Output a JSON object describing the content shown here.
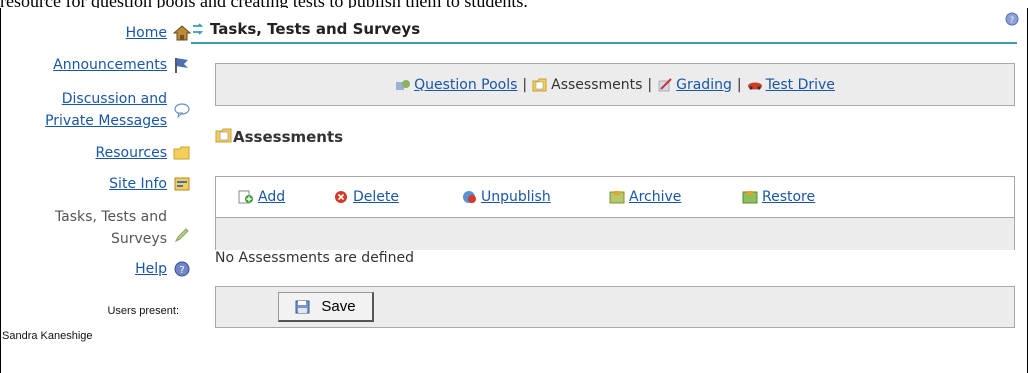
{
  "top_fragment": "resource for question pools and creating tests to publish them to students.",
  "sidebar": {
    "items": [
      {
        "label": "Home",
        "icon": "home-icon",
        "link": true
      },
      {
        "label": "Announcements",
        "icon": "flag-icon",
        "link": true
      },
      {
        "label": "Discussion and Private Messages",
        "line1": "Discussion and",
        "line2": "Private Messages",
        "icon": "chat-bubble-icon",
        "link": true
      },
      {
        "label": "Resources",
        "icon": "folder-icon",
        "link": true
      },
      {
        "label": "Site Info",
        "icon": "site-info-icon",
        "link": true
      },
      {
        "label": "Tasks, Tests and Surveys",
        "line1": "Tasks, Tests and",
        "line2": "Surveys",
        "icon": "pencil-icon",
        "link": false
      },
      {
        "label": "Help",
        "icon": "help-icon",
        "link": true
      }
    ],
    "users_present_label": "Users present:",
    "users": [
      "Sandra Kaneshige"
    ]
  },
  "main": {
    "title": "Tasks, Tests and Surveys",
    "nav": {
      "question_pools": "Question Pools",
      "assessments": "Assessments",
      "grading": "Grading",
      "test_drive": "Test Drive",
      "separator": "|"
    },
    "section_title": "Assessments",
    "actions": {
      "add": "Add",
      "delete": "Delete",
      "unpublish": "Unpublish",
      "archive": "Archive",
      "restore": "Restore"
    },
    "empty_message": "No Assessments are defined",
    "save_label": "Save"
  },
  "colors": {
    "link": "#1a56a7",
    "title_rule": "#3b9cab",
    "bar_bg": "#ececec"
  }
}
